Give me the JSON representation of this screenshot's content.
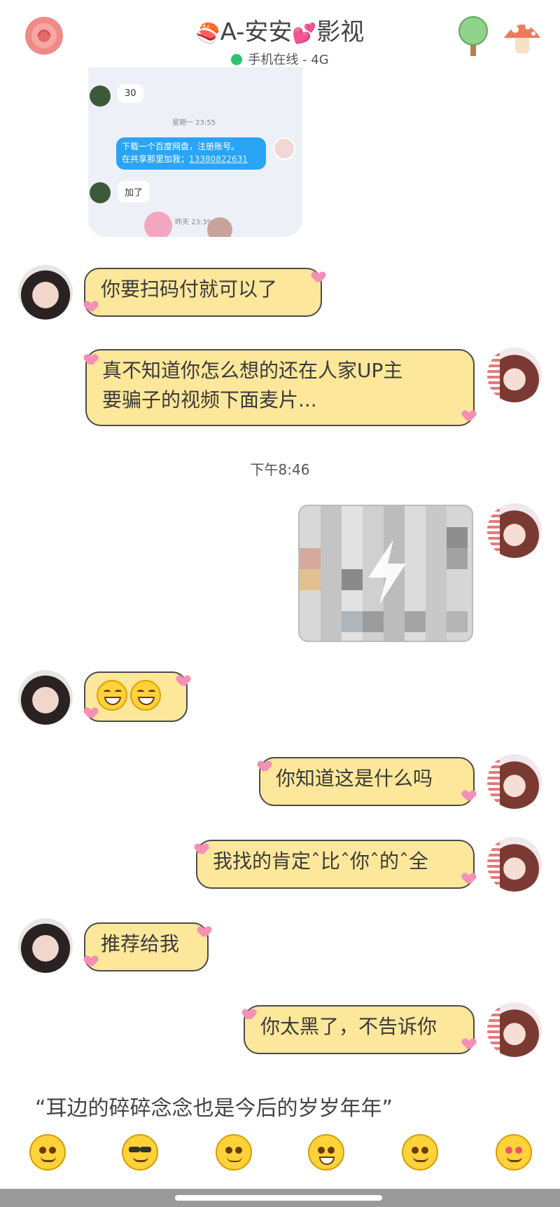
{
  "header": {
    "title": "A-安安",
    "title_suffix": "影视",
    "status": "手机在线 - 4G",
    "status_color": "#2fc36d"
  },
  "embedded": {
    "msg_30": "30",
    "time1": "星期一 23:55",
    "blue_line1": "下载一个百度网盘，注册账号。",
    "blue_line2": "在共享那里加我；",
    "blue_phone": "13380822631",
    "msg_joined": "加了",
    "time2": "昨天 23:39"
  },
  "messages": {
    "m1": "你要扫码付就可以了",
    "m2_line1": "真不知道你怎么想的还在人家UP主",
    "m2_line2": "要骗子的视频下面麦片...",
    "timestamp": "下午8:46",
    "m4": "你知道这是什么吗",
    "m5": "我找的肯定ˆ比ˆ你ˆ的ˆ全",
    "m6": "推荐给我",
    "m7": "你太黑了，不告诉你"
  },
  "footer": {
    "quote": "“耳边的碎碎念念也是今后的岁岁年年”"
  },
  "colors": {
    "bubble": "#fde79a",
    "heart": "#f58fb5",
    "blue_bubble": "#2aa4f4"
  }
}
